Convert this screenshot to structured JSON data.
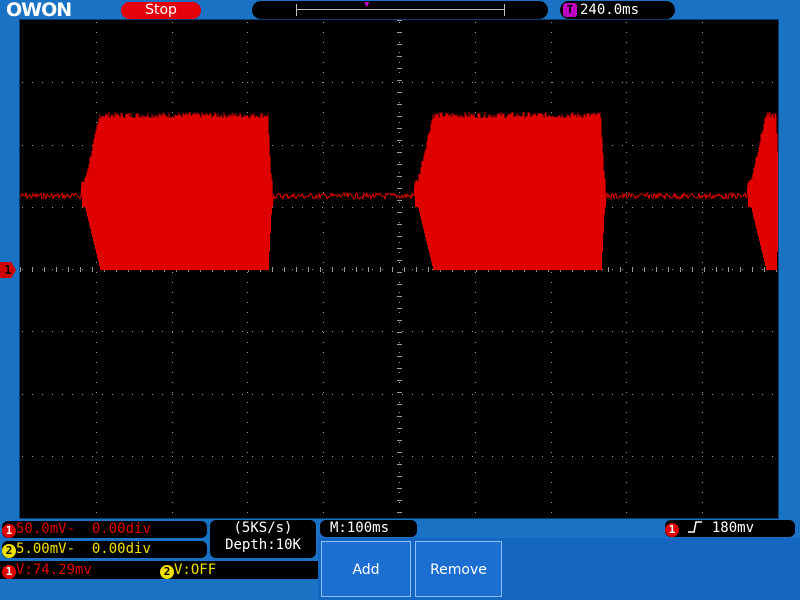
{
  "brand": {
    "logo": "OWON"
  },
  "header": {
    "status": "Stop",
    "trigger_position": "240.0ms",
    "trigger_position_badge": "T"
  },
  "channels": {
    "ch1": {
      "badge": "1",
      "scale": "50.0mV-",
      "offset": "0.00div",
      "color": "#e00000"
    },
    "ch2": {
      "badge": "2",
      "scale": "5.00mV-",
      "offset": "0.00div",
      "color": "#f0e000"
    }
  },
  "acquisition": {
    "sample_rate": "(5KS/s)",
    "depth": "Depth:10K"
  },
  "timebase": {
    "label": "M:100ms"
  },
  "trigger": {
    "badge": "1",
    "level": "180mv",
    "edge_icon": "rising-edge-icon"
  },
  "measurements": {
    "ch1": {
      "badge": "1",
      "text": "V:74.29mv"
    },
    "ch2": {
      "badge": "2",
      "text": "V:OFF"
    }
  },
  "menu": {
    "add_label": "Add",
    "remove_label": "Remove"
  },
  "waveform_marker": {
    "badge": "1"
  }
}
